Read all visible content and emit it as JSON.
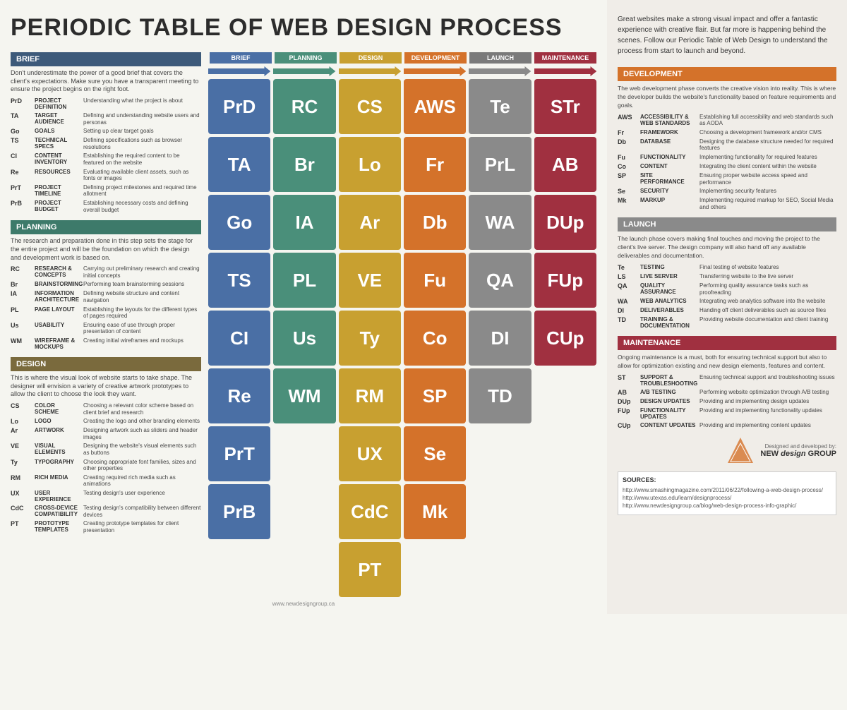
{
  "title": "PERIODIC TABLE OF WEB DESIGN PROCESS",
  "right_intro": "Great websites make a strong visual impact and offer a fantastic experience with creative flair. But far more is happening behind the scenes. Follow our Periodic Table of Web Design to understand the process from start to launch and beyond.",
  "sections": {
    "brief": {
      "label": "BRIEF",
      "desc": "Don't underestimate the power of a good brief that covers the client's expectations. Make sure you have a transparent meeting to ensure the project begins on the right foot.",
      "items": [
        {
          "code": "PrD",
          "name": "PROJECT DEFINITION",
          "desc": "Understanding what the project is about"
        },
        {
          "code": "TA",
          "name": "TARGET AUDIENCE",
          "desc": "Defining and understanding website users and personas"
        },
        {
          "code": "Go",
          "name": "GOALS",
          "desc": "Setting up clear target goals"
        },
        {
          "code": "TS",
          "name": "TECHNICAL SPECS",
          "desc": "Defining specifications such as browser resolutions"
        },
        {
          "code": "CI",
          "name": "CONTENT INVENTORY",
          "desc": "Establishing the required content to be featured on the website"
        },
        {
          "code": "Re",
          "name": "RESOURCES",
          "desc": "Evaluating available client assets, such as fonts or images"
        },
        {
          "code": "PrT",
          "name": "PROJECT TIMELINE",
          "desc": "Defining project milestones and required time allotment"
        },
        {
          "code": "PrB",
          "name": "PROJECT BUDGET",
          "desc": "Establishing necessary costs and defining overall budget"
        }
      ]
    },
    "planning": {
      "label": "PLANNING",
      "desc": "The research and preparation done in this step sets the stage for the entire project and will be the foundation on which the design and development work is based on.",
      "items": [
        {
          "code": "RC",
          "name": "RESEARCH & CONCEPTS",
          "desc": "Carrying out preliminary research and creating initial concepts"
        },
        {
          "code": "Br",
          "name": "BRAINSTORMING",
          "desc": "Performing team brainstorming sessions"
        },
        {
          "code": "IA",
          "name": "INFORMATION ARCHITECTURE",
          "desc": "Defining website structure and content navigation"
        },
        {
          "code": "PL",
          "name": "PAGE LAYOUT",
          "desc": "Establishing the layouts for the different types of pages required"
        },
        {
          "code": "Us",
          "name": "USABILITY",
          "desc": "Ensuring ease of use through proper presentation of content"
        },
        {
          "code": "WM",
          "name": "WIREFRAME & MOCKUPS",
          "desc": "Creating initial wireframes and mockups"
        }
      ]
    },
    "design": {
      "label": "DESIGN",
      "desc": "This is where the visual look of website starts to take shape. The designer will envision a variety of creative artwork prototypes to allow the client to choose the look they want.",
      "items": [
        {
          "code": "CS",
          "name": "COLOR SCHEME",
          "desc": "Choosing a relevant color scheme based on client brief and research"
        },
        {
          "code": "Lo",
          "name": "LOGO",
          "desc": "Creating the logo and other branding elements"
        },
        {
          "code": "Ar",
          "name": "ARTWORK",
          "desc": "Designing artwork such as sliders and header images"
        },
        {
          "code": "VE",
          "name": "VISUAL ELEMENTS",
          "desc": "Designing the website's visual elements such as buttons"
        },
        {
          "code": "Ty",
          "name": "TYPOGRAPHY",
          "desc": "Choosing appropriate font families, sizes and other properties"
        },
        {
          "code": "RM",
          "name": "RICH MEDIA",
          "desc": "Creating required rich media such as animations"
        },
        {
          "code": "UX",
          "name": "USER EXPERIENCE",
          "desc": "Testing design's user experience"
        },
        {
          "code": "CdC",
          "name": "CROSS-DEVICE COMPATIBILITY",
          "desc": "Testing design's compatibility between different devices"
        },
        {
          "code": "PT",
          "name": "PROTOTYPE TEMPLATES",
          "desc": "Creating prototype templates for client presentation"
        }
      ]
    }
  },
  "columns": [
    "BRIEF",
    "PLANNING",
    "DESIGN",
    "DEVELOPMENT",
    "LAUNCH",
    "MAINTENANCE"
  ],
  "grid": [
    [
      {
        "text": "PrD",
        "type": "brief-c"
      },
      {
        "text": "RC",
        "type": "planning-c"
      },
      {
        "text": "CS",
        "type": "design-c"
      },
      {
        "text": "AWS",
        "type": "dev-c"
      },
      {
        "text": "Te",
        "type": "launch-c"
      },
      {
        "text": "STr",
        "type": "maint-c"
      }
    ],
    [
      {
        "text": "TA",
        "type": "brief-c"
      },
      {
        "text": "Br",
        "type": "planning-c"
      },
      {
        "text": "Lo",
        "type": "design-c"
      },
      {
        "text": "Fr",
        "type": "dev-c"
      },
      {
        "text": "PrL",
        "type": "launch-c"
      },
      {
        "text": "AB",
        "type": "maint-c"
      }
    ],
    [
      {
        "text": "Go",
        "type": "brief-c"
      },
      {
        "text": "IA",
        "type": "planning-c"
      },
      {
        "text": "Ar",
        "type": "design-c"
      },
      {
        "text": "Db",
        "type": "dev-c"
      },
      {
        "text": "WA",
        "type": "launch-c"
      },
      {
        "text": "DUp",
        "type": "maint-c"
      }
    ],
    [
      {
        "text": "TS",
        "type": "brief-c"
      },
      {
        "text": "PL",
        "type": "planning-c"
      },
      {
        "text": "VE",
        "type": "design-c"
      },
      {
        "text": "Fu",
        "type": "dev-c"
      },
      {
        "text": "QA",
        "type": "launch-c"
      },
      {
        "text": "FUp",
        "type": "maint-c"
      }
    ],
    [
      {
        "text": "CI",
        "type": "brief-c"
      },
      {
        "text": "Us",
        "type": "planning-c"
      },
      {
        "text": "Ty",
        "type": "design-c"
      },
      {
        "text": "Co",
        "type": "dev-c"
      },
      {
        "text": "DI",
        "type": "launch-c"
      },
      {
        "text": "CUp",
        "type": "maint-c"
      }
    ],
    [
      {
        "text": "Re",
        "type": "brief-c"
      },
      {
        "text": "WM",
        "type": "planning-c"
      },
      {
        "text": "RM",
        "type": "design-c"
      },
      {
        "text": "SP",
        "type": "dev-c"
      },
      {
        "text": "TD",
        "type": "launch-c"
      },
      {
        "text": "",
        "type": "empty"
      }
    ],
    [
      {
        "text": "PrT",
        "type": "brief-c"
      },
      {
        "text": "",
        "type": "empty"
      },
      {
        "text": "UX",
        "type": "design-c"
      },
      {
        "text": "Se",
        "type": "dev-c"
      },
      {
        "text": "",
        "type": "empty"
      },
      {
        "text": "",
        "type": "empty"
      }
    ],
    [
      {
        "text": "PrB",
        "type": "brief-c"
      },
      {
        "text": "",
        "type": "empty"
      },
      {
        "text": "CdC",
        "type": "design-c"
      },
      {
        "text": "Mk",
        "type": "dev-c"
      },
      {
        "text": "",
        "type": "empty"
      },
      {
        "text": "",
        "type": "empty"
      }
    ],
    [
      {
        "text": "",
        "type": "empty"
      },
      {
        "text": "",
        "type": "empty"
      },
      {
        "text": "PT",
        "type": "design-c"
      },
      {
        "text": "",
        "type": "empty"
      },
      {
        "text": "",
        "type": "empty"
      },
      {
        "text": "",
        "type": "empty"
      }
    ]
  ],
  "right": {
    "development": {
      "label": "DEVELOPMENT",
      "desc": "The web development phase converts the creative vision into reality. This is where the developer builds the website's functionality based on feature requirements and goals.",
      "items": [
        {
          "code": "AWS",
          "name": "ACCESSIBILITY & WEB STANDARDS",
          "desc": "Establishing full accessibility and web standards such as AODA"
        },
        {
          "code": "Fr",
          "name": "FRAMEWORK",
          "desc": "Choosing a development framework and/or CMS"
        },
        {
          "code": "Db",
          "name": "DATABASE",
          "desc": "Designing the database structure needed for required features"
        },
        {
          "code": "Fu",
          "name": "FUNCTIONALITY",
          "desc": "Implementing functionality for required features"
        },
        {
          "code": "Co",
          "name": "CONTENT",
          "desc": "Integrating the client content within the website"
        },
        {
          "code": "SP",
          "name": "SITE PERFORMANCE",
          "desc": "Ensuring proper website access speed and performance"
        },
        {
          "code": "Se",
          "name": "SECURITY",
          "desc": "Implementing security features"
        },
        {
          "code": "Mk",
          "name": "MARKUP",
          "desc": "Implementing required markup for SEO, Social Media and others"
        }
      ]
    },
    "launch": {
      "label": "LAUNCH",
      "desc": "The launch phase covers making final touches and moving the project to the client's live server. The design company will also hand off any available deliverables and documentation.",
      "items": [
        {
          "code": "Te",
          "name": "TESTING",
          "desc": "Final testing of website features"
        },
        {
          "code": "LS",
          "name": "LIVE SERVER",
          "desc": "Transferring website to the live server"
        },
        {
          "code": "QA",
          "name": "QUALITY ASSURANCE",
          "desc": "Performing quality assurance tasks such as proofreading"
        },
        {
          "code": "WA",
          "name": "WEB ANALYTICS",
          "desc": "Integrating web analytics software into the website"
        },
        {
          "code": "DI",
          "name": "DELIVERABLES",
          "desc": "Handing off client deliverables such as source files"
        },
        {
          "code": "TD",
          "name": "TRAINING & DOCUMENTATION",
          "desc": "Providing website documentation and client training"
        }
      ]
    },
    "maintenance": {
      "label": "MAINTENANCE",
      "desc": "Ongoing maintenance is a must, both for ensuring technical support but also to allow for optimization existing and new design elements, features and content.",
      "items": [
        {
          "code": "ST",
          "name": "SUPPORT & TROUBLESHOOTING",
          "desc": "Ensuring technical support and troubleshooting issues"
        },
        {
          "code": "AB",
          "name": "A/B TESTING",
          "desc": "Performing website optimization through A/B testing"
        },
        {
          "code": "DUp",
          "name": "DESIGN UPDATES",
          "desc": "Providing and implementing design updates"
        },
        {
          "code": "FUp",
          "name": "FUNCTIONALITY UPDATES",
          "desc": "Providing and implementing functionality updates"
        },
        {
          "code": "CUp",
          "name": "CONTENT UPDATES",
          "desc": "Providing and implementing content updates"
        }
      ]
    }
  },
  "sources": {
    "title": "SOURCES:",
    "links": [
      "http://www.smashingmagazine.com/2011/06/22/following-a-web-design-process/",
      "http://www.utexas.edu/learn/designprocess/",
      "http://www.newdesigngroup.ca/blog/web-design-process-info-graphic/"
    ]
  },
  "logo": {
    "line1": "Designed and developed by:",
    "name": "NEW design GROUP"
  },
  "website": "www.newdesigngroup.ca"
}
